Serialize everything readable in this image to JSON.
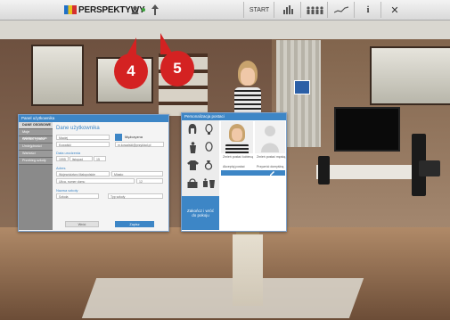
{
  "topbar": {
    "logo": "PERSPEKTYWY",
    "start_label": "START",
    "close_icon": "✕",
    "info_icon": "i"
  },
  "markers": [
    "4",
    "5"
  ],
  "panel_left": {
    "title": "Panel użytkownika",
    "side_items": [
      "DANE OSOBOWE",
      "Moje zainteresowania",
      "Wiedza i praca",
      "Umiejętności",
      "Wartości",
      "Przebieg szkoły"
    ],
    "section_personal": "Dane użytkownika",
    "field_name": "Maciej",
    "field_surname": "Kowalski",
    "gender_label": "Mężczyzna",
    "field_email": "m.kowalski@przyklad.pl",
    "section_birth": "Data urodzenia",
    "birth_year": "1995",
    "birth_month": "listopad",
    "birth_day": "15",
    "section_address": "Adres",
    "field_province": "Województwo Małopolskie",
    "field_city": "Miasto",
    "field_street": "Ulica, numer domu",
    "field_number": "12",
    "section_school": "Nazwa szkoły",
    "field_school": "Szkoła",
    "field_school_type": "Typ szkoły",
    "back_label": "Wróć",
    "save_label": "Zapisz"
  },
  "panel_right": {
    "title": "Personalizacja postaci",
    "option_female": "Zmień postać kobiecą",
    "option_male": "Zmień postać męską",
    "option_accept": "Akceptuj postać",
    "option_default": "Przywróć domyślną",
    "bottom_label": "Zakończ i wróć do pokoju"
  }
}
